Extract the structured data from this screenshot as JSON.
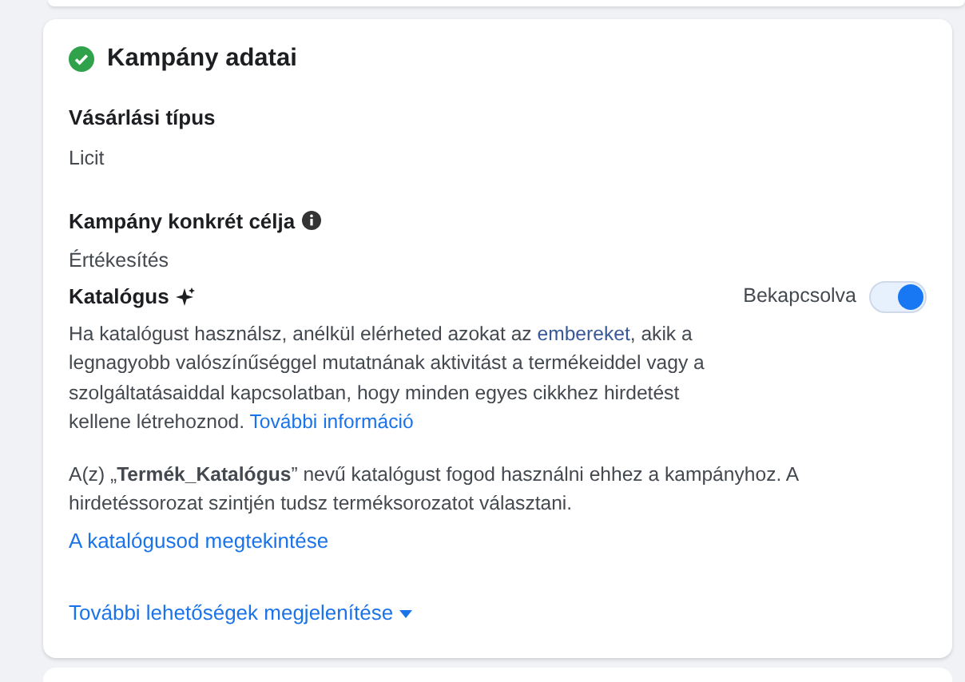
{
  "card": {
    "title": "Kampány adatai",
    "completed": true
  },
  "fields": [
    {
      "label": "Vásárlási típus",
      "value": "Licit",
      "info": false
    },
    {
      "label": "Kampány konkrét célja",
      "value": "Értékesítés",
      "info": true
    }
  ],
  "catalog": {
    "label": "Katalógus",
    "toggle_label": "Bekapcsolva",
    "on": true,
    "description": [
      {
        "kind": "text",
        "text": "Ha katalógust használsz, anélkül elérheted azokat az "
      },
      {
        "kind": "term",
        "text": "embereket"
      },
      {
        "kind": "text",
        "text": ", akik a legnagyobb valószínűséggel mutatnának aktivitást a termékeiddel vagy a szolgáltatásaiddal kapcsolatban, hogy minden egyes cikkhez hirdetést kellene létrehoznod. "
      },
      {
        "kind": "link",
        "text": "További információ"
      }
    ],
    "note": "A(z) „**Termék_Katalógus**” nevű katalógust fogod használni ehhez a kampányhoz. A hirdetéssorozat szintjén tudsz terméksorozatot választani.",
    "view_link": "A katalógusod megtekintése"
  },
  "more_link": "További lehetőségek megjelenítése"
}
